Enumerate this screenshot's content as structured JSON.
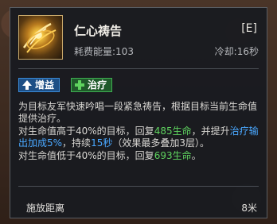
{
  "skill": {
    "name": "仁心祷告",
    "hotkey": "[E]",
    "energy_cost": "耗费能量:103",
    "cooldown": "冷却:16秒",
    "tags": [
      {
        "label": "增益",
        "icon": "up-arrow-icon",
        "color": "#1d4f86"
      },
      {
        "label": "治疗",
        "icon": "plus-icon",
        "color": "#1f5a2a"
      }
    ],
    "description": {
      "p1": "为目标友军快速吟唱一段紧急祷告，根据目标当前生命值提供治疗。",
      "p2_a": "对生命值高于40%的目标，回复",
      "p2_heal": "485生命",
      "p2_b": "，并提升",
      "p2_buff": "治疗输出加成5%",
      "p2_c": "，持续",
      "p2_dur": "15秒",
      "p2_d": "（效果最多叠加3层）。",
      "p3_a": "对生命值低于40%的目标，回复",
      "p3_heal": "693生命",
      "p3_b": "。"
    },
    "range_label": "施放距离",
    "range_value": "8米"
  },
  "colors": {
    "heal_green": "#5fd35f",
    "buff_blue": "#4aa8ff"
  }
}
